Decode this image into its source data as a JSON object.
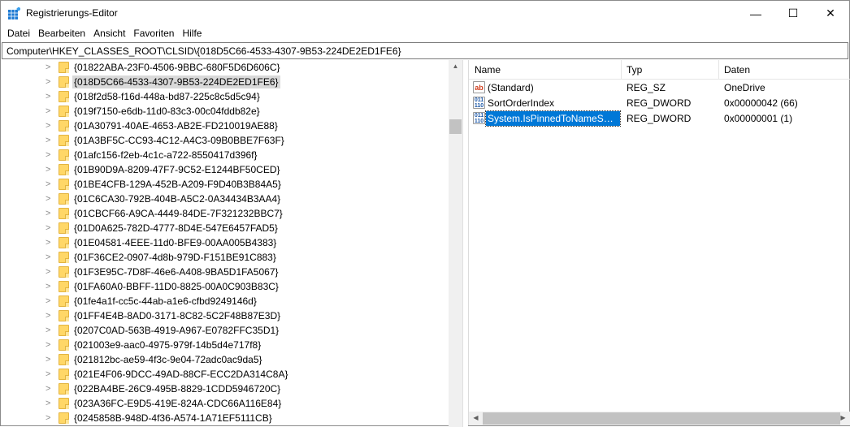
{
  "window": {
    "title": "Registrierungs-Editor",
    "minimize": "—",
    "maximize": "☐",
    "close": "✕"
  },
  "menu": [
    "Datei",
    "Bearbeiten",
    "Ansicht",
    "Favoriten",
    "Hilfe"
  ],
  "address": "Computer\\HKEY_CLASSES_ROOT\\CLSID\\{018D5C66-4533-4307-9B53-224DE2ED1FE6}",
  "tree": {
    "selected_index": 1,
    "items": [
      "{01822ABA-23F0-4506-9BBC-680F5D6D606C}",
      "{018D5C66-4533-4307-9B53-224DE2ED1FE6}",
      "{018f2d58-f16d-448a-bd87-225c8c5d5c94}",
      "{019f7150-e6db-11d0-83c3-00c04fddb82e}",
      "{01A30791-40AE-4653-AB2E-FD210019AE88}",
      "{01A3BF5C-CC93-4C12-A4C3-09B0BBE7F63F}",
      "{01afc156-f2eb-4c1c-a722-8550417d396f}",
      "{01B90D9A-8209-47F7-9C52-E1244BF50CED}",
      "{01BE4CFB-129A-452B-A209-F9D40B3B84A5}",
      "{01C6CA30-792B-404B-A5C2-0A34434B3AA4}",
      "{01CBCF66-A9CA-4449-84DE-7F321232BBC7}",
      "{01D0A625-782D-4777-8D4E-547E6457FAD5}",
      "{01E04581-4EEE-11d0-BFE9-00AA005B4383}",
      "{01F36CE2-0907-4d8b-979D-F151BE91C883}",
      "{01F3E95C-7D8F-46e6-A408-9BA5D1FA5067}",
      "{01FA60A0-BBFF-11D0-8825-00A0C903B83C}",
      "{01fe4a1f-cc5c-44ab-a1e6-cfbd9249146d}",
      "{01FF4E4B-8AD0-3171-8C82-5C2F48B87E3D}",
      "{0207C0AD-563B-4919-A967-E0782FFC35D1}",
      "{021003e9-aac0-4975-979f-14b5d4e717f8}",
      "{021812bc-ae59-4f3c-9e04-72adc0ac9da5}",
      "{021E4F06-9DCC-49AD-88CF-ECC2DA314C8A}",
      "{022BA4BE-26C9-495B-8829-1CDD5946720C}",
      "{023A36FC-E9D5-419E-824A-CDC66A116E84}",
      "{0245858B-948D-4f36-A574-1A71EF5111CB}"
    ]
  },
  "values": {
    "columns": {
      "name": "Name",
      "type": "Typ",
      "data": "Daten"
    },
    "rows": [
      {
        "icon": "string-value-icon",
        "glyph": "ab",
        "name": "(Standard)",
        "type": "REG_SZ",
        "data": "OneDrive",
        "selected": false
      },
      {
        "icon": "binary-value-icon",
        "glyph": "011\n110",
        "name": "SortOrderIndex",
        "type": "REG_DWORD",
        "data": "0x00000042 (66)",
        "selected": false
      },
      {
        "icon": "binary-value-icon",
        "glyph": "011\n110",
        "name": "System.IsPinnedToNameSpa...",
        "type": "REG_DWORD",
        "data": "0x00000001 (1)",
        "selected": true
      }
    ]
  },
  "colors": {
    "selection": "#0078d7",
    "folder": "#ffd767"
  }
}
